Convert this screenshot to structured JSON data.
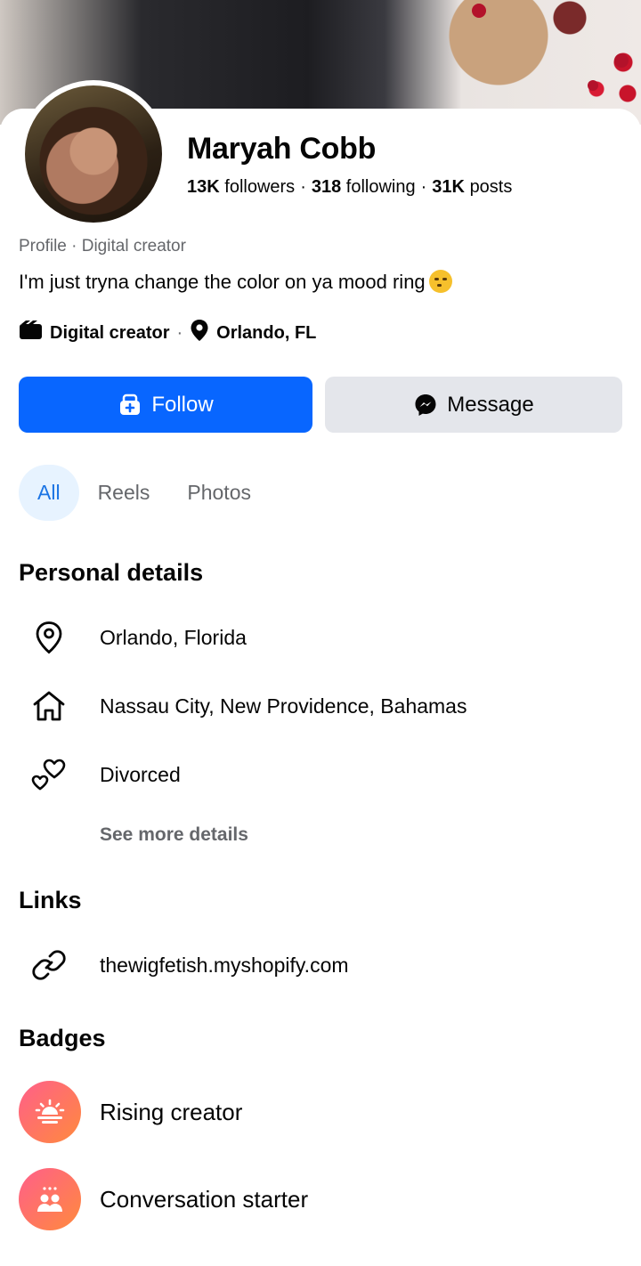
{
  "profile": {
    "name": "Maryah Cobb",
    "followers_count": "13K",
    "followers_label": "followers",
    "following_count": "318",
    "following_label": "following",
    "posts_count": "31K",
    "posts_label": "posts",
    "category_line": "Profile · Digital creator",
    "bio": "I'm just tryna change the color on ya mood ring",
    "tag_category": "Digital creator",
    "tag_location": "Orlando, FL"
  },
  "actions": {
    "follow_label": "Follow",
    "message_label": "Message"
  },
  "tabs": [
    {
      "label": "All",
      "active": true
    },
    {
      "label": "Reels",
      "active": false
    },
    {
      "label": "Photos",
      "active": false
    }
  ],
  "personal_details": {
    "title": "Personal details",
    "items": [
      {
        "icon": "location-pin-icon",
        "text": "Orlando, Florida"
      },
      {
        "icon": "home-icon",
        "text": "Nassau City, New Providence, Bahamas"
      },
      {
        "icon": "hearts-icon",
        "text": "Divorced"
      }
    ],
    "see_more": "See more details"
  },
  "links": {
    "title": "Links",
    "items": [
      {
        "icon": "link-icon",
        "text": "thewigfetish.myshopify.com"
      }
    ]
  },
  "badges": {
    "title": "Badges",
    "items": [
      {
        "icon": "sunrise-icon",
        "text": "Rising creator"
      },
      {
        "icon": "people-icon",
        "text": "Conversation starter"
      }
    ]
  },
  "colors": {
    "primary_blue": "#0866ff",
    "secondary_gray": "#e4e6eb",
    "tab_active_bg": "#e7f3ff",
    "tab_active_text": "#1b74e4",
    "muted_text": "#65676b"
  }
}
